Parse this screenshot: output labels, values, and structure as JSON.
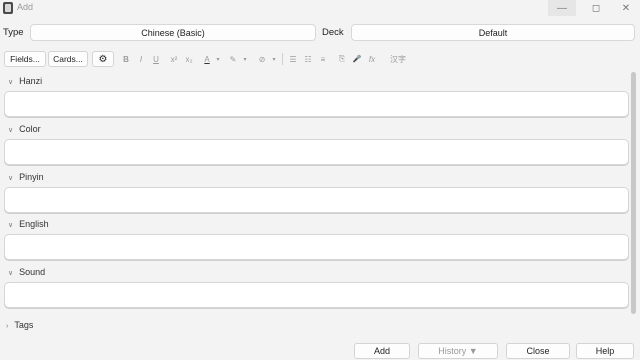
{
  "window": {
    "title": "Add",
    "minimize_icon": "minimize-icon",
    "maximize_icon": "maximize-icon",
    "close_icon": "close-icon"
  },
  "type_row": {
    "type_label": "Type",
    "type_value": "Chinese (Basic)",
    "deck_label": "Deck",
    "deck_value": "Default"
  },
  "toolbar": {
    "fields_label": "Fields...",
    "cards_label": "Cards...",
    "format_buttons": [
      "B",
      "I",
      "U",
      "x²",
      "x₂",
      "A",
      "▾",
      "✎",
      "▾",
      "⊘",
      "▾",
      "☰",
      "☷",
      "≡",
      "⎘",
      "🎤",
      "fx",
      "汉字"
    ]
  },
  "fields": [
    {
      "label": "Hanzi",
      "value": ""
    },
    {
      "label": "Color",
      "value": ""
    },
    {
      "label": "Pinyin",
      "value": ""
    },
    {
      "label": "English",
      "value": ""
    },
    {
      "label": "Sound",
      "value": ""
    }
  ],
  "tags": {
    "label": "Tags"
  },
  "buttons": {
    "add": "Add",
    "history": "History ▼",
    "close": "Close",
    "help": "Help"
  },
  "colors": {
    "background": "#f3f3f3",
    "field_background": "#ffffff",
    "border": "#d6d6d6"
  }
}
